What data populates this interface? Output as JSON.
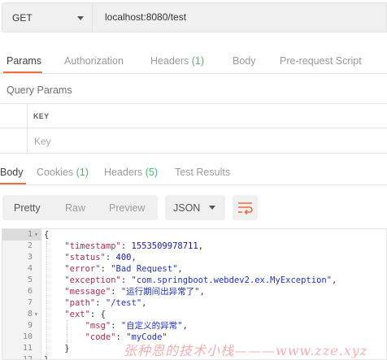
{
  "request": {
    "method": "GET",
    "url": "localhost:8080/test"
  },
  "request_tabs": [
    {
      "label": "Params",
      "count": "",
      "active": true
    },
    {
      "label": "Authorization",
      "count": "",
      "active": false
    },
    {
      "label": "Headers",
      "count": "(1)",
      "active": false
    },
    {
      "label": "Body",
      "count": "",
      "active": false
    },
    {
      "label": "Pre-request Script",
      "count": "",
      "active": false
    }
  ],
  "query_params": {
    "title": "Query Params",
    "key_header": "KEY",
    "key_placeholder": "Key"
  },
  "response_tabs": [
    {
      "label": "Body",
      "count": "",
      "active": true
    },
    {
      "label": "Cookies",
      "count": "(1)",
      "active": false
    },
    {
      "label": "Headers",
      "count": "(5)",
      "active": false
    },
    {
      "label": "Test Results",
      "count": "",
      "active": false
    }
  ],
  "response_view": {
    "modes": [
      "Pretty",
      "Raw",
      "Preview"
    ],
    "active_mode": "Pretty",
    "format": "JSON",
    "wrap_icon": "wrap-lines-icon",
    "accent_color": "#f26b3a"
  },
  "code_lines": [
    {
      "n": "1",
      "fold": "▾",
      "text": "{"
    },
    {
      "n": "2",
      "fold": "",
      "text": "    \"timestamp\": 1553509978711,"
    },
    {
      "n": "3",
      "fold": "",
      "text": "    \"status\": 400,"
    },
    {
      "n": "4",
      "fold": "",
      "text": "    \"error\": \"Bad Request\","
    },
    {
      "n": "5",
      "fold": "",
      "text": "    \"exception\": \"com.springboot.webdev2.ex.MyException\","
    },
    {
      "n": "6",
      "fold": "",
      "text": "    \"message\": \"运行期间出异常了\","
    },
    {
      "n": "7",
      "fold": "",
      "text": "    \"path\": \"/test\","
    },
    {
      "n": "8",
      "fold": "▾",
      "text": "    \"ext\": {"
    },
    {
      "n": "9",
      "fold": "",
      "text": "        \"msg\": \"自定义的异常\","
    },
    {
      "n": "10",
      "fold": "",
      "text": "        \"code\": \"myCode\""
    },
    {
      "n": "11",
      "fold": "",
      "text": "    }"
    },
    {
      "n": "12",
      "fold": "",
      "text": "}"
    }
  ],
  "watermark": "张种恩的技术小栈———www.zze.xyz"
}
